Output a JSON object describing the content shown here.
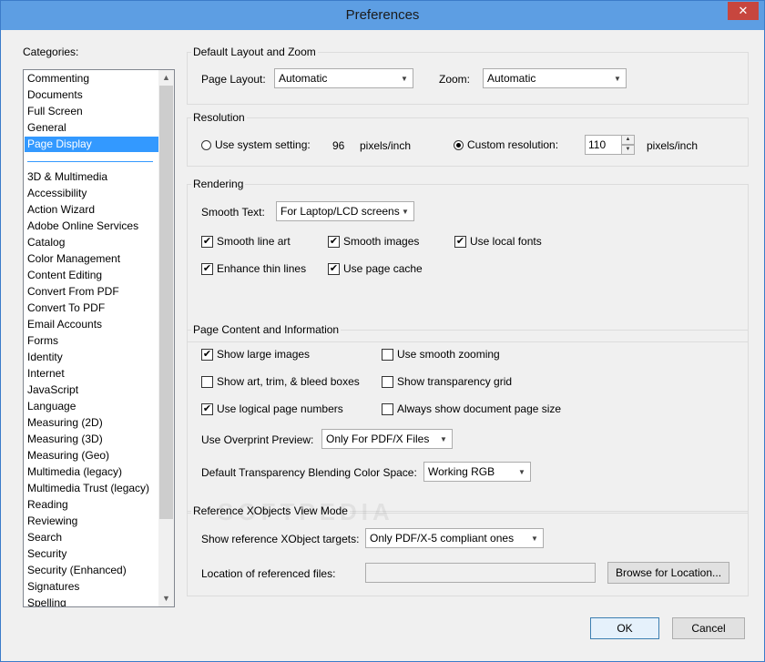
{
  "window": {
    "title": "Preferences",
    "close_label": "✕"
  },
  "categories": {
    "label": "Categories:",
    "top_items": [
      "Commenting",
      "Documents",
      "Full Screen",
      "General",
      "Page Display"
    ],
    "items": [
      "3D & Multimedia",
      "Accessibility",
      "Action Wizard",
      "Adobe Online Services",
      "Catalog",
      "Color Management",
      "Content Editing",
      "Convert From PDF",
      "Convert To PDF",
      "Email Accounts",
      "Forms",
      "Identity",
      "Internet",
      "JavaScript",
      "Language",
      "Measuring (2D)",
      "Measuring (3D)",
      "Measuring (Geo)",
      "Multimedia (legacy)",
      "Multimedia Trust (legacy)",
      "Reading",
      "Reviewing",
      "Search",
      "Security",
      "Security (Enhanced)",
      "Signatures",
      "Spelling"
    ],
    "selected": "Page Display"
  },
  "layout_zoom": {
    "title": "Default Layout and Zoom",
    "page_layout_label": "Page Layout:",
    "page_layout_value": "Automatic",
    "zoom_label": "Zoom:",
    "zoom_value": "Automatic"
  },
  "resolution": {
    "title": "Resolution",
    "system_label": "Use system setting:",
    "system_value": "96",
    "system_unit": "pixels/inch",
    "custom_label": "Custom resolution:",
    "custom_value": "110",
    "custom_unit": "pixels/inch",
    "selected": "custom"
  },
  "rendering": {
    "title": "Rendering",
    "smooth_text_label": "Smooth Text:",
    "smooth_text_value": "For Laptop/LCD screens",
    "smooth_line_art": "Smooth line art",
    "smooth_images": "Smooth images",
    "use_local_fonts": "Use local fonts",
    "enhance_thin_lines": "Enhance thin lines",
    "use_page_cache": "Use page cache",
    "checked": {
      "smooth_line_art": true,
      "smooth_images": true,
      "use_local_fonts": true,
      "enhance_thin_lines": true,
      "use_page_cache": true
    }
  },
  "page_content": {
    "title": "Page Content and Information",
    "show_large_images": "Show large images",
    "use_smooth_zooming": "Use smooth zooming",
    "show_art_boxes": "Show art, trim, & bleed boxes",
    "show_transparency_grid": "Show transparency grid",
    "use_logical_page_numbers": "Use logical page numbers",
    "always_show_page_size": "Always show document page size",
    "checked": {
      "show_large_images": true,
      "use_smooth_zooming": false,
      "show_art_boxes": false,
      "show_transparency_grid": false,
      "use_logical_page_numbers": true,
      "always_show_page_size": false
    },
    "overprint_label": "Use Overprint Preview:",
    "overprint_value": "Only For PDF/X Files",
    "blending_label": "Default Transparency Blending Color Space:",
    "blending_value": "Working RGB"
  },
  "xobjects": {
    "title": "Reference XObjects View Mode",
    "targets_label": "Show reference XObject targets:",
    "targets_value": "Only PDF/X-5 compliant ones",
    "location_label": "Location of referenced files:",
    "location_value": "",
    "browse_label": "Browse for Location..."
  },
  "footer": {
    "ok_label": "OK",
    "cancel_label": "Cancel"
  },
  "watermark": "SOFTPEDIA",
  "colors": {
    "accent": "#3399ff",
    "titlebar": "#5d9ee3",
    "close": "#c7463e"
  }
}
